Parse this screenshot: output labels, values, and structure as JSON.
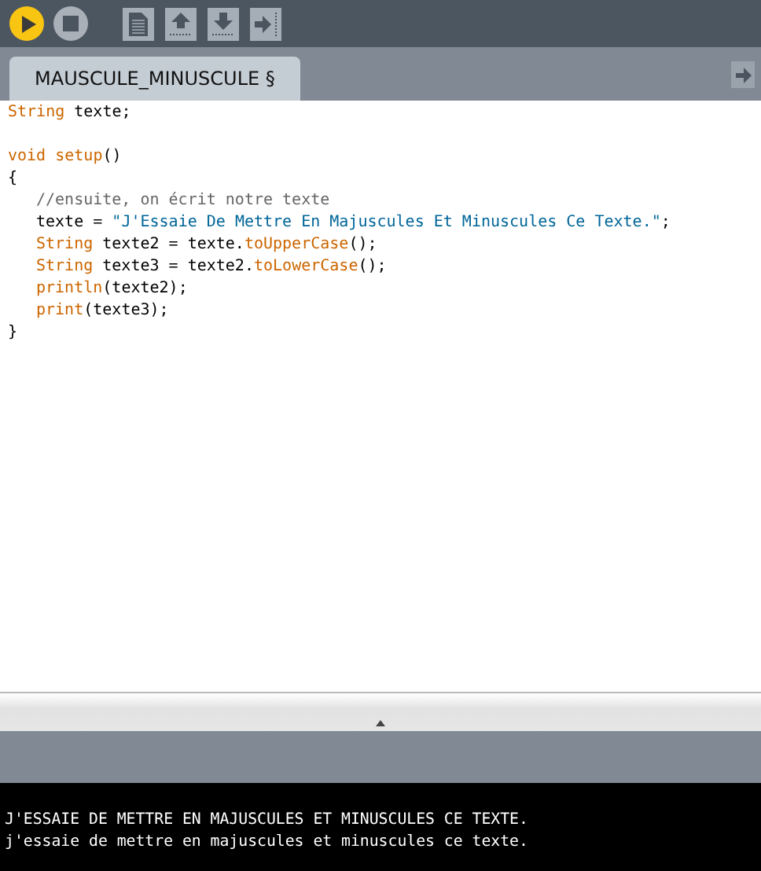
{
  "toolbar": {
    "buttons": [
      {
        "kind": "run"
      },
      {
        "kind": "stop"
      },
      {
        "kind": "new"
      },
      {
        "kind": "open"
      },
      {
        "kind": "save"
      },
      {
        "kind": "export"
      }
    ]
  },
  "tabs": [
    {
      "label": "MAUSCULE_MINUSCULE §",
      "selected": true
    }
  ],
  "editor": {
    "lines": [
      {
        "kind": "code",
        "tokens": [
          {
            "kind": "keyword",
            "text": "String"
          },
          {
            "kind": "plain",
            "text": " texte;"
          }
        ]
      },
      {
        "kind": "blank"
      },
      {
        "kind": "code",
        "tokens": [
          {
            "kind": "keyword",
            "text": "void "
          },
          {
            "kind": "keyword",
            "text": "setup"
          },
          {
            "kind": "plain",
            "text": "()"
          }
        ]
      },
      {
        "kind": "code",
        "tokens": [
          {
            "kind": "plain",
            "text": "{"
          }
        ],
        "children": [
          {
            "kind": "code",
            "tokens": [
              {
                "kind": "comment",
                "text": "//ensuite, on écrit notre texte"
              }
            ]
          },
          {
            "kind": "code",
            "tokens": [
              {
                "kind": "plain",
                "text": "texte = "
              },
              {
                "kind": "string",
                "text": "\"J'Essaie De Mettre En Majuscules Et Minuscules Ce Texte.\""
              },
              {
                "kind": "plain",
                "text": ";"
              }
            ]
          },
          {
            "kind": "code",
            "tokens": [
              {
                "kind": "keyword",
                "text": "String"
              },
              {
                "kind": "plain",
                "text": " texte2 = texte."
              },
              {
                "kind": "keyword",
                "text": "toUpperCase"
              },
              {
                "kind": "plain",
                "text": "();"
              }
            ]
          },
          {
            "kind": "code",
            "tokens": [
              {
                "kind": "keyword",
                "text": "String"
              },
              {
                "kind": "plain",
                "text": " texte3 = texte2."
              },
              {
                "kind": "keyword",
                "text": "toLowerCase"
              },
              {
                "kind": "plain",
                "text": "();"
              }
            ]
          },
          {
            "kind": "code",
            "tokens": [
              {
                "kind": "keyword",
                "text": "println"
              },
              {
                "kind": "plain",
                "text": "(texte2);"
              }
            ]
          },
          {
            "kind": "code",
            "tokens": [
              {
                "kind": "keyword",
                "text": "print"
              },
              {
                "kind": "plain",
                "text": "(texte3);"
              }
            ]
          }
        ]
      },
      {
        "kind": "code",
        "tokens": [
          {
            "kind": "plain",
            "text": "}"
          }
        ]
      }
    ]
  },
  "console": {
    "lines": [
      "J'ESSAIE DE METTRE EN MAJUSCULES ET MINUSCULES CE TEXTE.",
      "j'essaie de mettre en majuscules et minuscules ce texte."
    ]
  }
}
